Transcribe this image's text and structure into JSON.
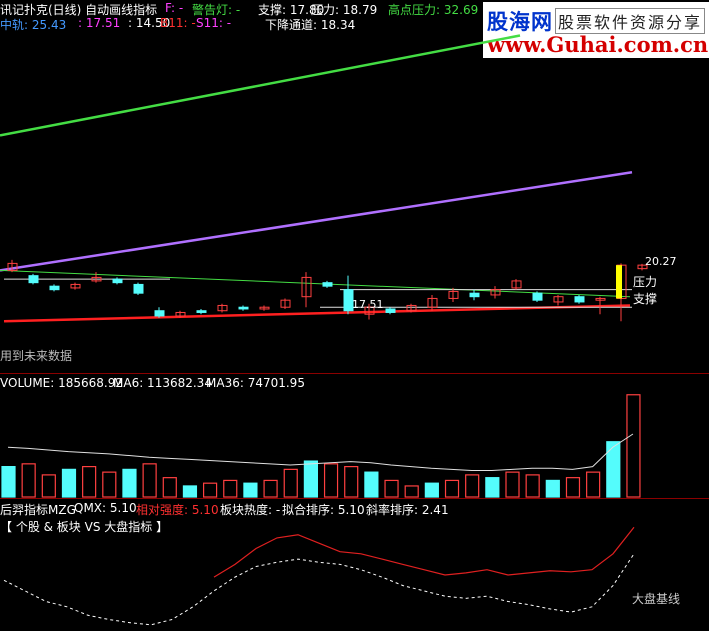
{
  "header": {
    "title": "讯记扑克(日线) 自动画线指标",
    "f_label": "F: -",
    "alarm": "警告灯: -",
    "support": "支撑: 17.80",
    "pressure": "压力: 18.79",
    "high_pressure": "高点压力: 32.69",
    "mid_track": "中轨: 25.43",
    "lower": ": 17.51",
    "lower2": ": 14.50",
    "b11": "B11: -",
    "s11": "S11: -",
    "down_channel": "下降通道: 18.34"
  },
  "logo": {
    "cn": "股海网",
    "cn2": "股票软件资源分享",
    "url": "www.Guhai.com.cn"
  },
  "price_panel": {
    "label_2027": "20.27",
    "label_1751": "17.51",
    "pressure_tag": "压力",
    "support_tag": "支撑",
    "future_note": "用到未来数据"
  },
  "volume_panel": {
    "volume": "VOLUME: 185668.92",
    "ma6": "MA6: 113682.34",
    "ma36": "MA36: 74701.95"
  },
  "indicator_panel": {
    "name": "后羿指标MZG",
    "qmx": "QMX: 5.10",
    "relative": "相对强度: 5.10",
    "sector_heat": "板块热度: -",
    "fit_rank": "拟合排序: 5.10",
    "slope_rank": "斜率排序: 2.41",
    "subtitle": "【 个股 & 板块 VS 大盘指标 】",
    "base_line": "大盘基线"
  },
  "colors": {
    "up": "#ff4040",
    "down": "#54fcfc",
    "green_line": "#44dd44",
    "purple_line": "#b070ff",
    "red_line": "#ff2020",
    "white_line": "#e0e0e0",
    "yellow": "#ffff00"
  },
  "chart_data": [
    {
      "type": "candlestick",
      "title": "讯记扑克(日线) 自动画线指标",
      "candles": [
        {
          "open": 19.9,
          "close": 20.3,
          "high": 20.5,
          "low": 19.8
        },
        {
          "open": 19.6,
          "close": 19.2,
          "high": 19.7,
          "low": 19.1
        },
        {
          "open": 19.0,
          "close": 18.8,
          "high": 19.1,
          "low": 18.7
        },
        {
          "open": 18.9,
          "close": 19.1,
          "high": 19.2,
          "low": 18.8
        },
        {
          "open": 19.3,
          "close": 19.5,
          "high": 19.8,
          "low": 19.2
        },
        {
          "open": 19.4,
          "close": 19.2,
          "high": 19.5,
          "low": 19.1
        },
        {
          "open": 19.1,
          "close": 18.6,
          "high": 19.2,
          "low": 18.5
        },
        {
          "open": 17.6,
          "close": 17.3,
          "high": 17.8,
          "low": 17.2
        },
        {
          "open": 17.3,
          "close": 17.5,
          "high": 17.6,
          "low": 17.2
        },
        {
          "open": 17.6,
          "close": 17.5,
          "high": 17.7,
          "low": 17.4
        },
        {
          "open": 17.6,
          "close": 17.9,
          "high": 18.0,
          "low": 17.5
        },
        {
          "open": 17.8,
          "close": 17.7,
          "high": 17.9,
          "low": 17.6
        },
        {
          "open": 17.7,
          "close": 17.8,
          "high": 17.9,
          "low": 17.6
        },
        {
          "open": 17.8,
          "close": 18.2,
          "high": 18.3,
          "low": 17.7
        },
        {
          "open": 18.4,
          "close": 19.5,
          "high": 19.8,
          "low": 17.8
        },
        {
          "open": 19.2,
          "close": 19.0,
          "high": 19.3,
          "low": 18.9
        },
        {
          "open": 18.8,
          "close": 17.6,
          "high": 19.6,
          "low": 17.4
        },
        {
          "open": 17.4,
          "close": 17.8,
          "high": 18.0,
          "low": 17.1
        },
        {
          "open": 17.7,
          "close": 17.5,
          "high": 17.8,
          "low": 17.4
        },
        {
          "open": 17.6,
          "close": 17.9,
          "high": 18.0,
          "low": 17.5
        },
        {
          "open": 17.8,
          "close": 18.3,
          "high": 18.5,
          "low": 17.6
        },
        {
          "open": 18.3,
          "close": 18.7,
          "high": 18.9,
          "low": 18.1
        },
        {
          "open": 18.6,
          "close": 18.4,
          "high": 18.8,
          "low": 18.2
        },
        {
          "open": 18.5,
          "close": 18.8,
          "high": 19.0,
          "low": 18.3
        },
        {
          "open": 18.9,
          "close": 19.3,
          "high": 19.4,
          "low": 18.8
        },
        {
          "open": 18.6,
          "close": 18.2,
          "high": 18.7,
          "low": 18.1
        },
        {
          "open": 18.1,
          "close": 18.4,
          "high": 18.5,
          "low": 17.9
        },
        {
          "open": 18.4,
          "close": 18.1,
          "high": 18.5,
          "low": 18.0
        },
        {
          "open": 18.2,
          "close": 18.3,
          "high": 18.4,
          "low": 17.4
        },
        {
          "open": 18.3,
          "close": 20.2,
          "high": 20.3,
          "low": 17.0
        },
        {
          "open": 20.0,
          "close": 20.2,
          "high": 20.27,
          "low": 19.9
        }
      ],
      "price_range": [
        16.5,
        33.5
      ]
    },
    {
      "type": "bar",
      "title": "VOLUME: 185668.92",
      "values": [
        55,
        60,
        40,
        50,
        55,
        45,
        50,
        60,
        35,
        20,
        25,
        30,
        25,
        30,
        50,
        65,
        60,
        55,
        45,
        30,
        20,
        25,
        30,
        40,
        35,
        45,
        40,
        30,
        35,
        45,
        100,
        185
      ],
      "ma6": [
        90,
        88,
        85,
        82,
        80,
        78,
        75,
        72,
        70,
        68,
        66,
        64,
        62,
        60,
        58,
        60,
        62,
        64,
        62,
        58,
        55,
        52,
        50,
        48,
        48,
        50,
        52,
        52,
        50,
        55,
        90,
        114
      ],
      "ylim": [
        0,
        190
      ]
    },
    {
      "type": "line",
      "title": "【 个股 & 板块 VS 大盘指标 】",
      "series": [
        {
          "values": [
            null,
            null,
            null,
            null,
            null,
            null,
            null,
            null,
            null,
            null,
            48,
            60,
            75,
            85,
            88,
            80,
            72,
            70,
            65,
            60,
            55,
            50,
            52,
            55,
            50,
            52,
            54,
            53,
            55,
            70,
            95
          ]
        },
        {
          "values": [
            45,
            35,
            25,
            20,
            12,
            8,
            5,
            3,
            8,
            20,
            35,
            48,
            58,
            62,
            65,
            62,
            60,
            55,
            48,
            40,
            35,
            30,
            28,
            30,
            25,
            22,
            18,
            15,
            20,
            40,
            70
          ]
        }
      ],
      "ylim": [
        0,
        100
      ]
    }
  ]
}
